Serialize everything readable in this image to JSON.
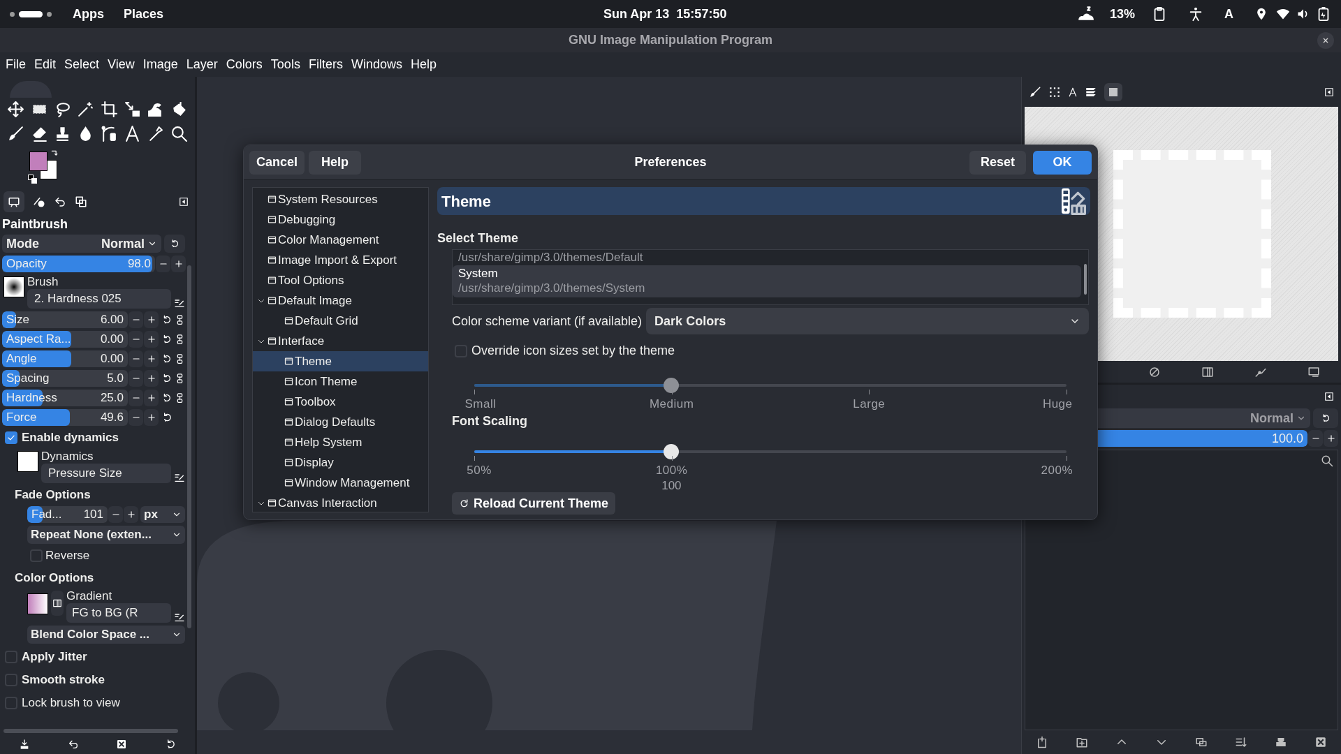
{
  "top_bar": {
    "apps": "Apps",
    "places": "Places",
    "clock": "Sun Apr 13  15:57:50",
    "battery": "13%",
    "keyboard_layout": "A"
  },
  "window": {
    "title": "GNU Image Manipulation Program"
  },
  "menu": [
    "File",
    "Edit",
    "Select",
    "View",
    "Image",
    "Layer",
    "Colors",
    "Tools",
    "Filters",
    "Windows",
    "Help"
  ],
  "tool_options": {
    "title": "Paintbrush",
    "mode": {
      "label": "Mode",
      "value": "Normal"
    },
    "opacity": {
      "label": "Opacity",
      "value": "98.0",
      "level": 0.98
    },
    "brush": {
      "label": "Brush",
      "value": "2. Hardness 025"
    },
    "sliders": [
      {
        "label": "Size",
        "value": "6.00",
        "level": 0.11,
        "kind": "chained"
      },
      {
        "label": "Aspect Ra...",
        "value": "0.00",
        "level": 0.55,
        "kind": "chained"
      },
      {
        "label": "Angle",
        "value": "0.00",
        "level": 0.55,
        "kind": "chained"
      },
      {
        "label": "Spacing",
        "value": "5.0",
        "level": 0.14,
        "kind": "chained"
      },
      {
        "label": "Hardness",
        "value": "25.0",
        "level": 0.32,
        "kind": "chained"
      },
      {
        "label": "Force",
        "value": "49.6",
        "level": 0.54,
        "kind": "reset"
      }
    ],
    "enable_dynamics": {
      "label": "Enable dynamics",
      "checked": true
    },
    "dynamics": {
      "label": "Dynamics",
      "value": "Pressure Size"
    },
    "fade": {
      "title": "Fade Options",
      "label": "Fad...",
      "value": "101",
      "level": 0.19,
      "unit": "px",
      "repeat": "Repeat None (exten...",
      "reverse": {
        "label": "Reverse",
        "checked": false
      }
    },
    "color_options": {
      "title": "Color Options",
      "label": "Gradient",
      "value": "FG to BG (R",
      "blend": "Blend Color Space ..."
    },
    "checkboxes": [
      {
        "label": "Apply Jitter",
        "checked": false,
        "kind": "expander"
      },
      {
        "label": "Smooth stroke",
        "checked": false,
        "kind": "expander"
      },
      {
        "label": "Lock brush to view",
        "checked": false,
        "kind": "plain"
      }
    ]
  },
  "preferences": {
    "title": "Preferences",
    "cancel": "Cancel",
    "help": "Help",
    "reset": "Reset",
    "ok": "OK",
    "tree": [
      {
        "label": "System Resources",
        "selected": false
      },
      {
        "label": "Debugging",
        "selected": false
      },
      {
        "label": "Color Management",
        "selected": false
      },
      {
        "label": "Image Import & Export",
        "selected": false
      },
      {
        "label": "Tool Options",
        "selected": false
      },
      {
        "label": "Default Image",
        "selected": false,
        "expanded": true,
        "children": [
          {
            "label": "Default Grid",
            "selected": false
          }
        ]
      },
      {
        "label": "Interface",
        "selected": false,
        "expanded": true,
        "children": [
          {
            "label": "Theme",
            "selected": true
          },
          {
            "label": "Icon Theme",
            "selected": false
          },
          {
            "label": "Toolbox",
            "selected": false
          },
          {
            "label": "Dialog Defaults",
            "selected": false
          },
          {
            "label": "Help System",
            "selected": false
          },
          {
            "label": "Display",
            "selected": false
          },
          {
            "label": "Window Management",
            "selected": false
          }
        ]
      },
      {
        "label": "Canvas Interaction",
        "selected": false,
        "expanded": true
      }
    ],
    "page": {
      "title": "Theme",
      "select_theme": "Select Theme",
      "themes": [
        {
          "path": "/usr/share/gimp/3.0/themes/Default",
          "selected": false
        },
        {
          "name": "System",
          "path": "/usr/share/gimp/3.0/themes/System",
          "selected": true
        }
      ],
      "color_scheme": {
        "label": "Color scheme variant (if available)",
        "value": "Dark Colors"
      },
      "override_icon_sizes": {
        "label": "Override icon sizes set by the theme",
        "checked": false
      },
      "icon_size": {
        "level": 0.333,
        "disabled": true,
        "marks": [
          "Small",
          "Medium",
          "Large",
          "Huge"
        ]
      },
      "font_scaling": {
        "title": "Font Scaling",
        "level": 0.333,
        "marks": [
          "50%",
          "100%",
          "200%"
        ],
        "value": "100"
      },
      "reload": "Reload Current Theme"
    }
  },
  "layers_panel": {
    "mode": "Normal",
    "opacity": {
      "value": "100.0",
      "level": 1
    }
  }
}
